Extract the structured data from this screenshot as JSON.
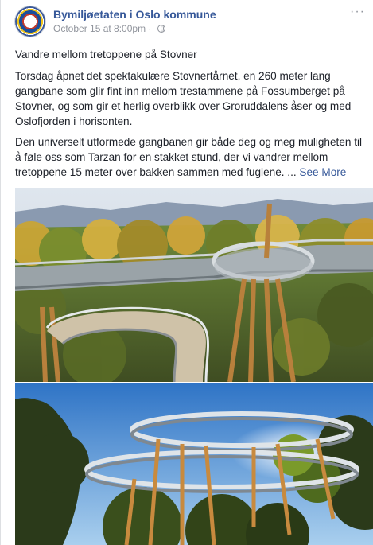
{
  "post": {
    "author": "Bymiljøetaten i Oslo kommune",
    "timestamp": "October 15 at 8:00pm",
    "separator": "·",
    "privacy_icon": "globe-icon",
    "menu_icon": "more-icon",
    "menu_glyph": "···",
    "title_line": "Vandre mellom tretoppene på Stovner",
    "paragraph1": "Torsdag åpnet det spektakulære Stovnertårnet, en 260 meter lang gangbane som glir fint inn mellom trestammene på Fossumberget på Stovner, og som gir et herlig overblikk over Groruddalens åser og med Oslofjorden i horisonten.",
    "paragraph2": "Den universelt utformede gangbanen gir både deg og meg muligheten til å føle oss som Tarzan for en stakket stund, der vi vandrer mellom tretoppene 15 meter over bakken sammen med fuglene. ...",
    "see_more": "See More",
    "colors": {
      "link": "#365899",
      "text": "#1d2129",
      "meta": "#90949c"
    }
  },
  "photos": [
    {
      "alt_icon": "photo-icon"
    },
    {
      "alt_icon": "photo-icon"
    }
  ]
}
